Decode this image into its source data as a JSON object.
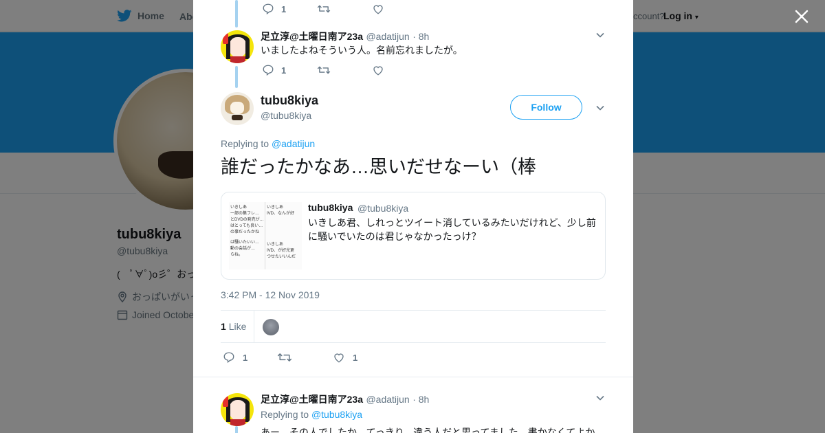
{
  "topbar": {
    "home_label": "Home",
    "about_label": "Abo",
    "account_text": "ccount?",
    "login_label": "Log in"
  },
  "profile": {
    "name": "tubu8kiya",
    "handle": "@tubu8kiya",
    "bio": "(　ﾟ∀ﾟ)o彡゜おっぱ",
    "location": "おっぱいがいっ",
    "joined": "Joined Octobe"
  },
  "thread": {
    "prev_actions": {
      "reply_count": "1"
    },
    "tweet1": {
      "name": "足立淳@土曜日南ア23a",
      "handle": "@adatijun",
      "time": "· 8h",
      "text": "いましたよねそういう人。名前忘れましたが。",
      "reply_count": "1"
    },
    "main": {
      "name": "tubu8kiya",
      "handle": "@tubu8kiya",
      "follow_label": "Follow",
      "replying_prefix": "Replying to",
      "replying_handle": "@adatijun",
      "text": "誰だったかなあ…思いだせなーい（棒",
      "quote": {
        "name": "tubu8kiya",
        "handle": "@tubu8kiya",
        "text": "いきしあ君、しれっとツイート消しているみたいだけれど、少し前に騒いでいたのは君じゃなかったっけ？",
        "image_labels": [
          "いきしあ",
          "いきしあ",
          "一部の集フレ…",
          "IVD、なんが好",
          "とDVDの発売が…",
          "はとっても良い…",
          "の事だったかね",
          "いきしあ",
          "は騒いたいい…",
          "IVD、が好光更",
          "動の会話が…",
          "つせたいいんだ",
          "らね。"
        ]
      },
      "timestamp": "3:42 PM - 12 Nov 2019",
      "likes_count": "1",
      "likes_label": "Like",
      "reply_count": "1",
      "like_count": "1"
    },
    "tweet3": {
      "name": "足立淳@土曜日南ア23a",
      "handle": "@adatijun",
      "time": "· 8h",
      "replying_prefix": "Replying to",
      "replying_handle": "@tubu8kiya",
      "text": "あー、その人でしたか。てっきり、違う人だと思ってました。書かなくてよか"
    }
  },
  "colors": {
    "accent": "#1da1f2",
    "thread_line": "#a5d2f0",
    "muted": "#657786",
    "overlay": "rgba(0,0,0,0.5)"
  }
}
